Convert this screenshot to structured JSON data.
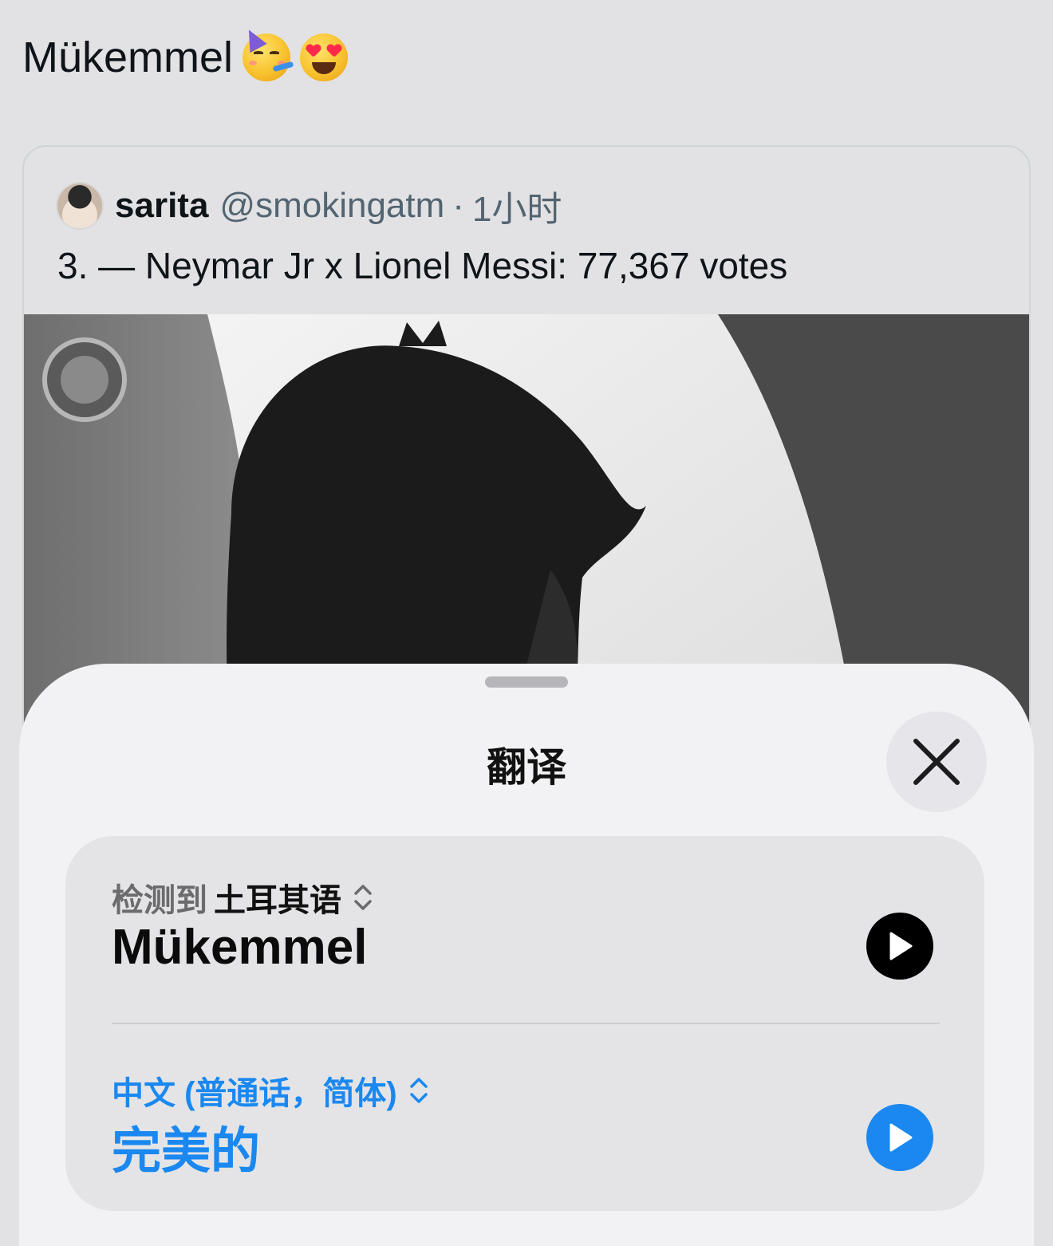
{
  "tweet": {
    "text": "Mükemmel",
    "emojis": [
      "partying-face-emoji",
      "heart-eyes-emoji"
    ]
  },
  "quote": {
    "author_name": "sarita",
    "author_handle": "@smokingatm",
    "separator": "·",
    "time": "1小时",
    "body": "3. — Neymar Jr x Lionel Messi: 77,367 votes",
    "media_icon": "video-thumbnail"
  },
  "translate_sheet": {
    "title": "翻译",
    "close_icon": "close-icon",
    "source": {
      "detected_label": "检测到",
      "language": "土耳其语",
      "text": "Mükemmel"
    },
    "target": {
      "language": "中文 (普通话，简体)",
      "text": "完美的"
    },
    "colors": {
      "accent": "#1a88f0",
      "sheet_bg": "#f2f2f4",
      "panel_bg": "#e4e4e6"
    }
  }
}
